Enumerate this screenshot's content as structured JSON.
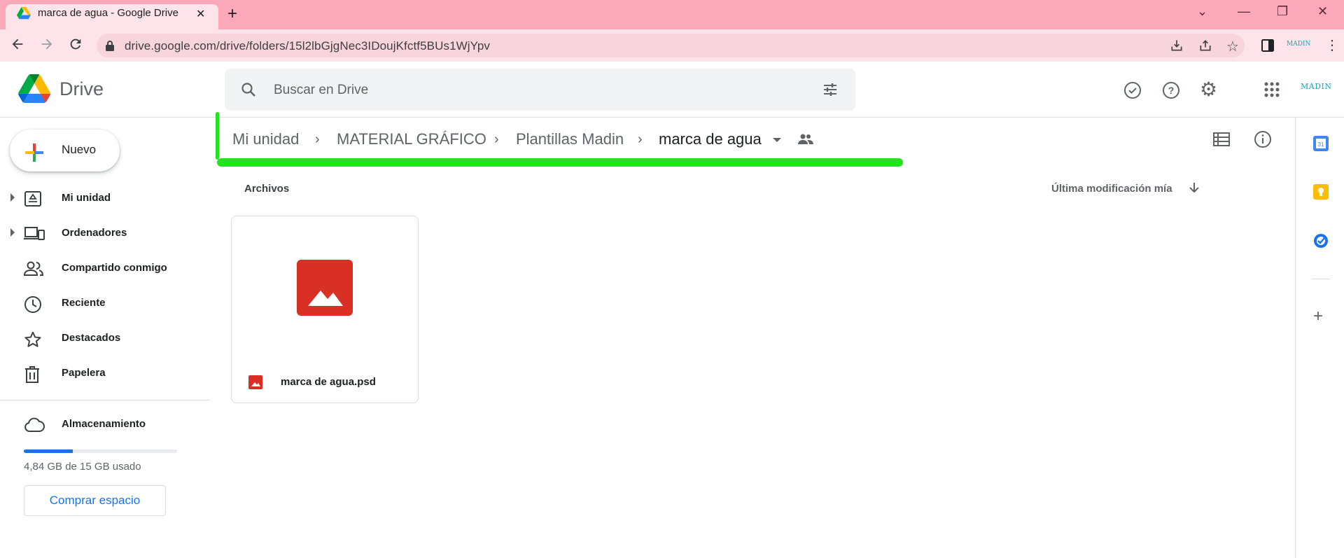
{
  "browser": {
    "tab_title": "marca de agua - Google Drive",
    "url": "drive.google.com/drive/folders/15l2lbGjgNec3IDoujKfctf5BUs1WjYpv"
  },
  "header": {
    "app_name": "Drive",
    "search_placeholder": "Buscar en Drive",
    "account_logo_text": "MADIN"
  },
  "sidebar": {
    "new_label": "Nuevo",
    "items": [
      {
        "label": "Mi unidad",
        "icon": "drive-icon",
        "expandable": true
      },
      {
        "label": "Ordenadores",
        "icon": "computer-icon",
        "expandable": true
      },
      {
        "label": "Compartido conmigo",
        "icon": "people-icon",
        "expandable": false
      },
      {
        "label": "Reciente",
        "icon": "clock-icon",
        "expandable": false
      },
      {
        "label": "Destacados",
        "icon": "star-icon",
        "expandable": false
      },
      {
        "label": "Papelera",
        "icon": "trash-icon",
        "expandable": false
      }
    ],
    "storage": {
      "label": "Almacenamiento",
      "usage_text": "4,84 GB de 15 GB usado",
      "used_fraction": 0.32,
      "buy_label": "Comprar espacio"
    }
  },
  "breadcrumb": {
    "items": [
      "Mi unidad",
      "MATERIAL GRÁFICO",
      "Plantillas Madin",
      "marca de agua"
    ]
  },
  "main": {
    "section_label": "Archivos",
    "sort_label": "Última modificación mía",
    "files": [
      {
        "name": "marca de agua.psd",
        "type": "image"
      }
    ]
  },
  "colors": {
    "tab_strip": "#fba8ba",
    "accent_blue": "#1a73e8",
    "file_red": "#d93025",
    "highlight_green": "#24e31c"
  }
}
